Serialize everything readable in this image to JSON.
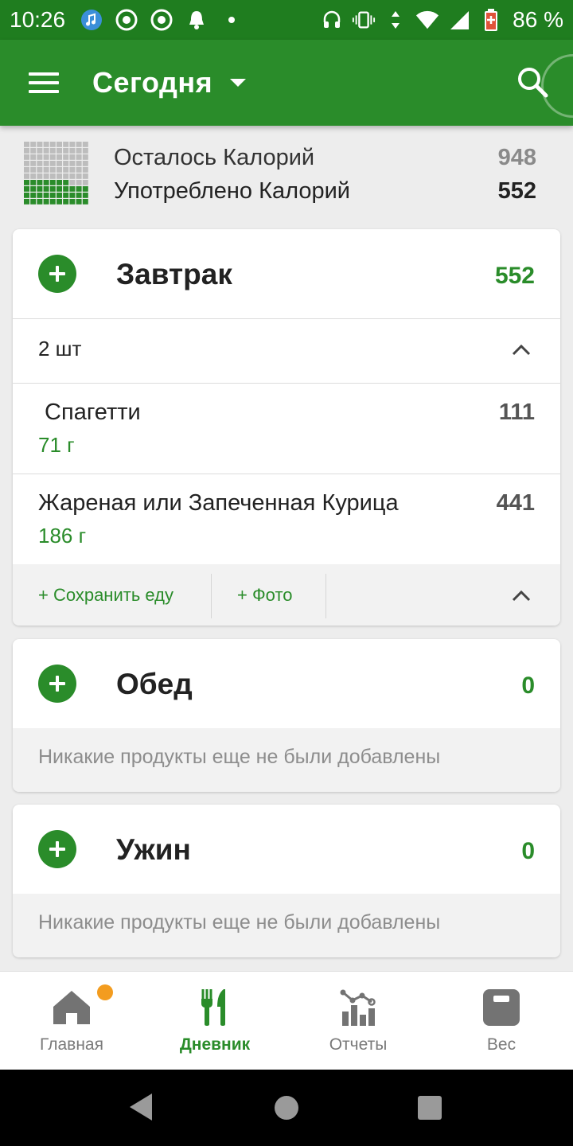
{
  "status_bar": {
    "time": "10:26",
    "battery_percent": "86 %",
    "icons": [
      "music-icon",
      "chrome-icon",
      "chrome-icon",
      "bell-icon",
      "dot-icon",
      "headset-icon",
      "vibrate-icon",
      "data-arrows-icon",
      "wifi-icon",
      "signal-icon",
      "battery-icon"
    ]
  },
  "app_bar": {
    "title": "Сегодня"
  },
  "summary": {
    "remaining_label": "Осталось Калорий",
    "remaining_value": "948",
    "consumed_label": "Употреблено Калорий",
    "consumed_value": "552",
    "consumed_fraction": 0.368
  },
  "meals": {
    "breakfast": {
      "name": "Завтрак",
      "calories": "552",
      "count": "2 шт",
      "items": [
        {
          "name": " Спагетти",
          "amount": "71 г",
          "calories": "111"
        },
        {
          "name": "Жареная или Запеченная Курица",
          "amount": "186 г",
          "calories": "441"
        }
      ],
      "save_label": "+ Сохранить еду",
      "photo_label": "+ Фото"
    },
    "lunch": {
      "name": "Обед",
      "calories": "0",
      "empty_text": "Никакие продукты еще не были добавлены"
    },
    "dinner": {
      "name": "Ужин",
      "calories": "0",
      "empty_text": "Никакие продукты еще не были добавлены"
    }
  },
  "bottom_nav": {
    "items": [
      {
        "label": "Главная",
        "icon": "home-icon",
        "active": false,
        "badge": true
      },
      {
        "label": "Дневник",
        "icon": "fork-knife-icon",
        "active": true
      },
      {
        "label": "Отчеты",
        "icon": "chart-icon",
        "active": false
      },
      {
        "label": "Вес",
        "icon": "scale-icon",
        "active": false
      }
    ]
  },
  "colors": {
    "brand_green": "#2a8c2a",
    "status_green": "#1f7d1f",
    "badge_orange": "#f39c1f"
  }
}
